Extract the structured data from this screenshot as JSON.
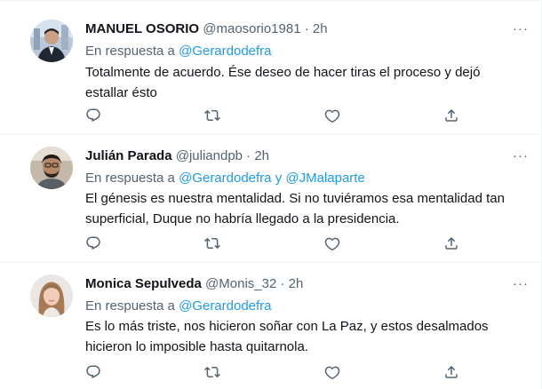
{
  "tweets": [
    {
      "name": "MANUEL OSORIO",
      "handle": "@maosorio1981",
      "dot": "·",
      "time": "2h",
      "reply_prefix": "En respuesta a",
      "reply_to": "@Gerardodefra",
      "reply_sep": "",
      "reply_to2": "",
      "text": "Totalmente de acuerdo. Ése deseo de hacer tiras el proceso y dejó estallar ésto",
      "more": "···"
    },
    {
      "name": "Julián Parada",
      "handle": "@juliandpb",
      "dot": "·",
      "time": "2h",
      "reply_prefix": "En respuesta a",
      "reply_to": "@Gerardodefra",
      "reply_sep": "y",
      "reply_to2": "@JMalaparte",
      "text": "El génesis es nuestra mentalidad. Si no tuviéramos esa mentalidad tan superficial, Duque no habría llegado a la presidencia.",
      "more": "···"
    },
    {
      "name": "Monica Sepulveda",
      "handle": "@Monis_32",
      "dot": "·",
      "time": "2h",
      "reply_prefix": "En respuesta a",
      "reply_to": "@Gerardodefra",
      "reply_sep": "",
      "reply_to2": "",
      "text": "Es lo más triste, nos hicieron soñar con La Paz, y estos desalmados hicieron lo imposible hasta quitarnola.",
      "more": "···"
    }
  ],
  "colors": {
    "text": "#0f1419",
    "secondary": "#536471",
    "link": "#1d9bf0",
    "border": "#eff3f4"
  },
  "icons": [
    "reply-icon",
    "retweet-icon",
    "like-icon",
    "share-icon"
  ]
}
